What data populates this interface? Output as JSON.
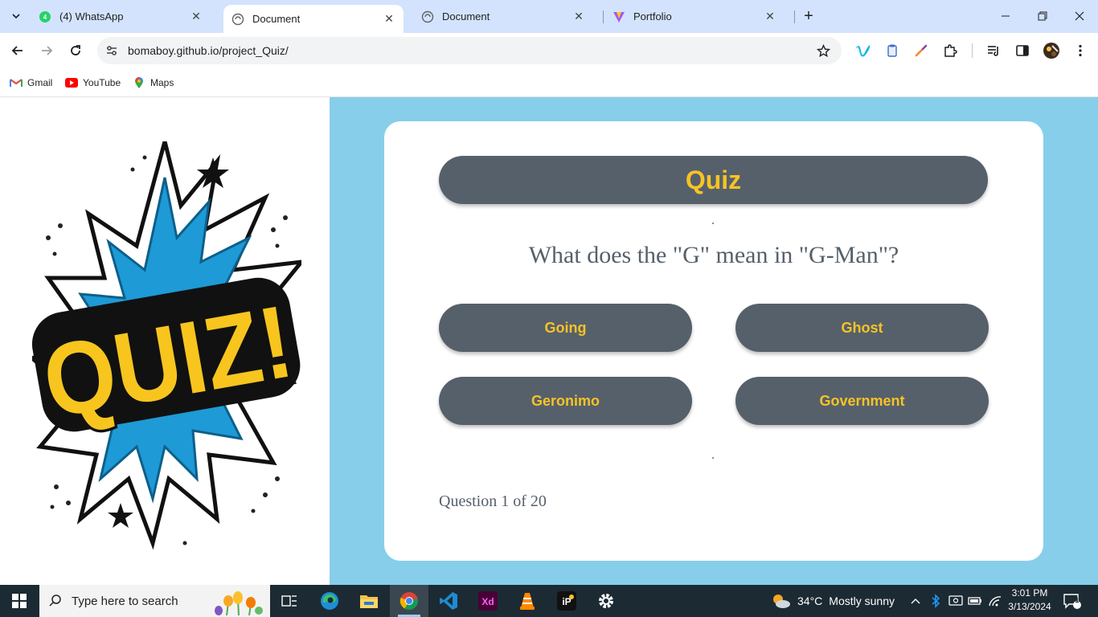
{
  "browser": {
    "tabs": [
      {
        "title": "(4) WhatsApp",
        "icon": "whatsapp-icon",
        "active": false
      },
      {
        "title": "Document",
        "icon": "globe-icon",
        "active": true
      },
      {
        "title": "Document",
        "icon": "globe-icon",
        "active": false
      },
      {
        "title": "Portfolio",
        "icon": "vite-icon",
        "active": false
      }
    ],
    "url": "bomaboy.github.io/project_Quiz/",
    "bookmarks": [
      {
        "label": "Gmail",
        "icon": "gmail-icon"
      },
      {
        "label": "YouTube",
        "icon": "youtube-icon"
      },
      {
        "label": "Maps",
        "icon": "maps-icon"
      }
    ]
  },
  "quiz": {
    "logo_text": "QUIZ!",
    "header": "Quiz",
    "question": "What does the \"G\" mean in \"G-Man\"?",
    "answers": [
      "Going",
      "Ghost",
      "Geronimo",
      "Government"
    ],
    "progress": "Question 1 of 20"
  },
  "colors": {
    "page_bg": "#87ceeb",
    "button_bg": "#56606b",
    "button_text": "#f7c325",
    "tabstrip_bg": "#d3e3fd",
    "taskbar_bg": "#1c2a33"
  },
  "taskbar": {
    "search_placeholder": "Type here to search",
    "apps": [
      "task-view-icon",
      "edge-icon",
      "file-explorer-icon",
      "chrome-icon",
      "vscode-icon",
      "xd-icon",
      "vlc-icon",
      "ipe-icon",
      "settings-icon"
    ],
    "weather": {
      "temp": "34°C",
      "condition": "Mostly sunny"
    },
    "time": "3:01 PM",
    "date": "3/13/2024",
    "notifications": "1"
  }
}
